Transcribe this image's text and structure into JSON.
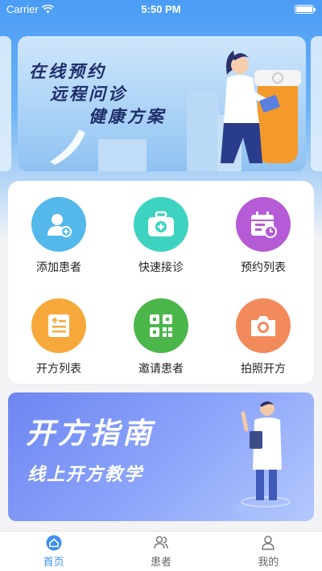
{
  "status_bar": {
    "carrier": "Carrier",
    "time": "5:50 PM"
  },
  "banner": {
    "line1": "在线预约",
    "line2": "远程问诊",
    "line3": "健康方案"
  },
  "functions": [
    {
      "label": "添加患者",
      "color": "#55b8ea",
      "icon": "add-patient-icon"
    },
    {
      "label": "快速接诊",
      "color": "#3ed3c0",
      "icon": "medical-kit-icon"
    },
    {
      "label": "预约列表",
      "color": "#b55bd6",
      "icon": "calendar-icon"
    },
    {
      "label": "开方列表",
      "color": "#f6a93a",
      "icon": "prescription-icon"
    },
    {
      "label": "邀请患者",
      "color": "#4bb64a",
      "icon": "qr-code-icon"
    },
    {
      "label": "拍照开方",
      "color": "#f28a5c",
      "icon": "camera-icon"
    }
  ],
  "guide": {
    "title": "开方指南",
    "subtitle": "线上开方教学"
  },
  "tabbar": {
    "active_color": "#3d8ef0",
    "items": [
      {
        "label": "首页",
        "icon": "home-icon",
        "active": true
      },
      {
        "label": "患者",
        "icon": "patients-icon",
        "active": false
      },
      {
        "label": "我的",
        "icon": "profile-icon",
        "active": false
      }
    ]
  }
}
